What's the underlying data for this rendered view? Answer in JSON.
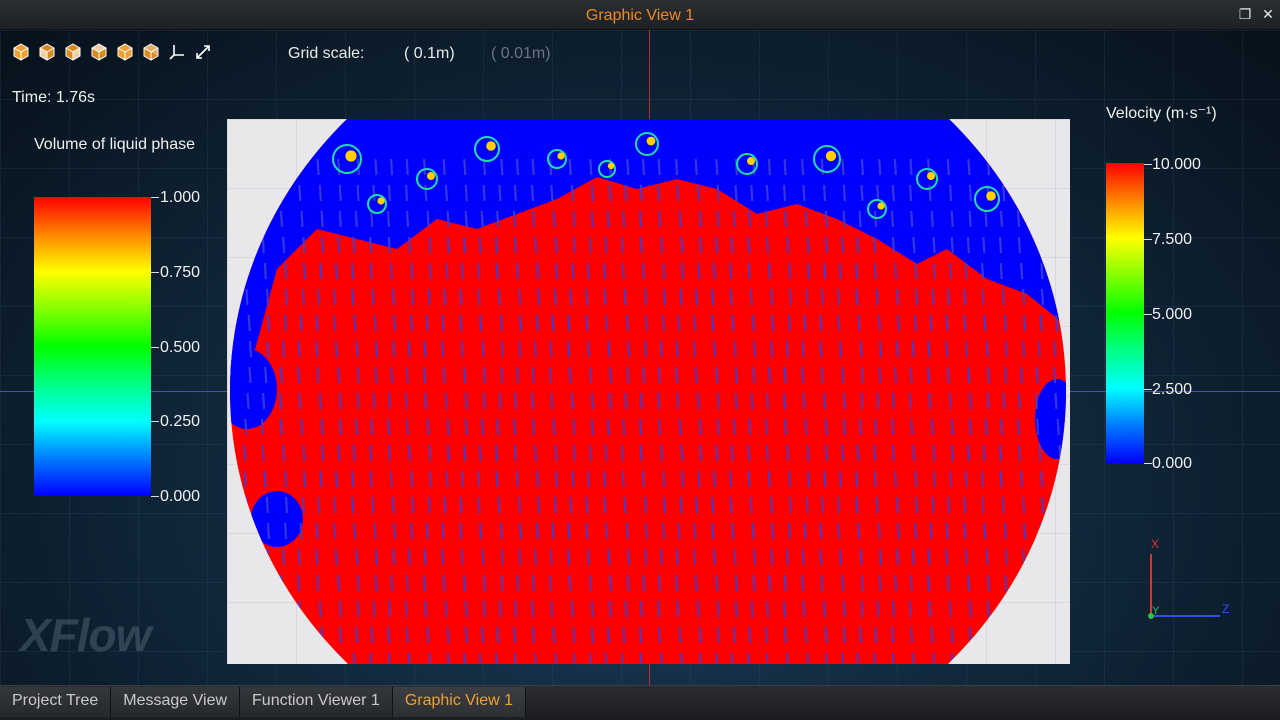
{
  "window": {
    "title": "Graphic View 1",
    "restore_icon": "restore-icon",
    "close_icon": "close-icon"
  },
  "toolbar": {
    "icons": [
      "view-cube-icon",
      "view-cube-front-icon",
      "view-cube-side-icon",
      "view-cube-top-icon",
      "view-cube-iso-icon",
      "view-cube-back-icon",
      "axis-triad-icon",
      "fit-view-icon"
    ],
    "accent": "#f0a030"
  },
  "grid": {
    "label": "Grid scale:",
    "primary": "( 0.1m)",
    "secondary": "( 0.01m)"
  },
  "time": "Time: 1.76s",
  "legend_left": {
    "title": "Volume of liquid phase",
    "ticks": [
      "1.000",
      "0.750",
      "0.500",
      "0.250",
      "0.000"
    ]
  },
  "legend_right": {
    "title": "Velocity (m·s⁻¹)",
    "ticks": [
      "10.000",
      "7.500",
      "5.000",
      "2.500",
      "0.000"
    ]
  },
  "axes": {
    "x": "X",
    "y": "Y",
    "z": "Z"
  },
  "logo": "XFlow",
  "colors": {
    "liquid": "#ff0000",
    "gas": "#0000ff",
    "title_accent": "#f08a1c"
  },
  "tabs": [
    {
      "label": "Project Tree",
      "active": false
    },
    {
      "label": "Message View",
      "active": false
    },
    {
      "label": "Function Viewer 1",
      "active": false
    },
    {
      "label": "Graphic View 1",
      "active": true
    }
  ]
}
